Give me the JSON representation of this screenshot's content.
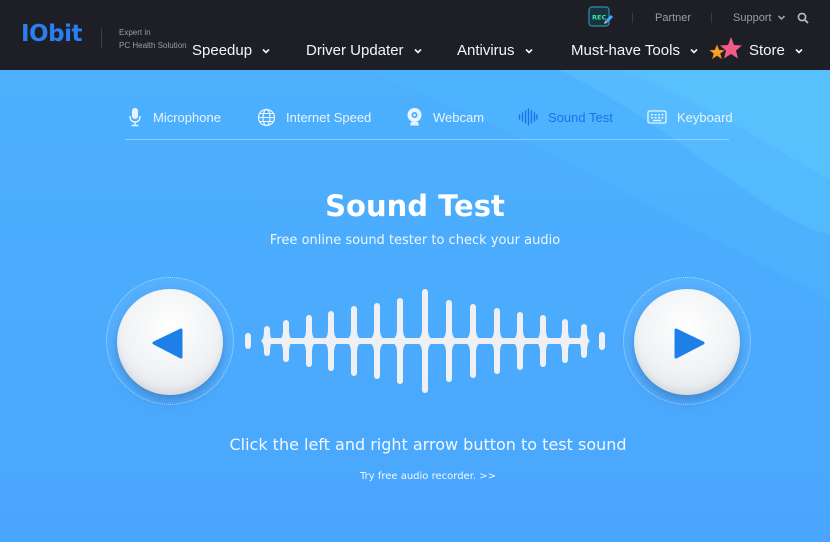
{
  "header": {
    "logo": "IObit",
    "tagline_line1": "Expert in",
    "tagline_line2": "PC Health Solution",
    "top_links": {
      "partner": "Partner",
      "support": "Support"
    },
    "nav": [
      {
        "label": "Speedup"
      },
      {
        "label": "Driver Updater"
      },
      {
        "label": "Antivirus"
      },
      {
        "label": "Must-have Tools"
      },
      {
        "label": "Store"
      }
    ],
    "rec_badge": "REC"
  },
  "tabs": [
    {
      "label": "Microphone",
      "icon": "microphone-icon",
      "active": false
    },
    {
      "label": "Internet Speed",
      "icon": "globe-icon",
      "active": false
    },
    {
      "label": "Webcam",
      "icon": "webcam-icon",
      "active": false
    },
    {
      "label": "Sound Test",
      "icon": "sound-wave-icon",
      "active": true
    },
    {
      "label": "Keyboard",
      "icon": "keyboard-icon",
      "active": false
    }
  ],
  "main": {
    "title": "Sound Test",
    "subtitle": "Free online sound tester to check your audio",
    "instruction": "Click the left and right arrow button to test sound",
    "recorder_link": "Try free audio recorder. >>"
  },
  "colors": {
    "header_bg": "#1e1f26",
    "page_bg": "#4aabfd",
    "accent": "#1a73e8",
    "logo": "#2a7ff0"
  }
}
